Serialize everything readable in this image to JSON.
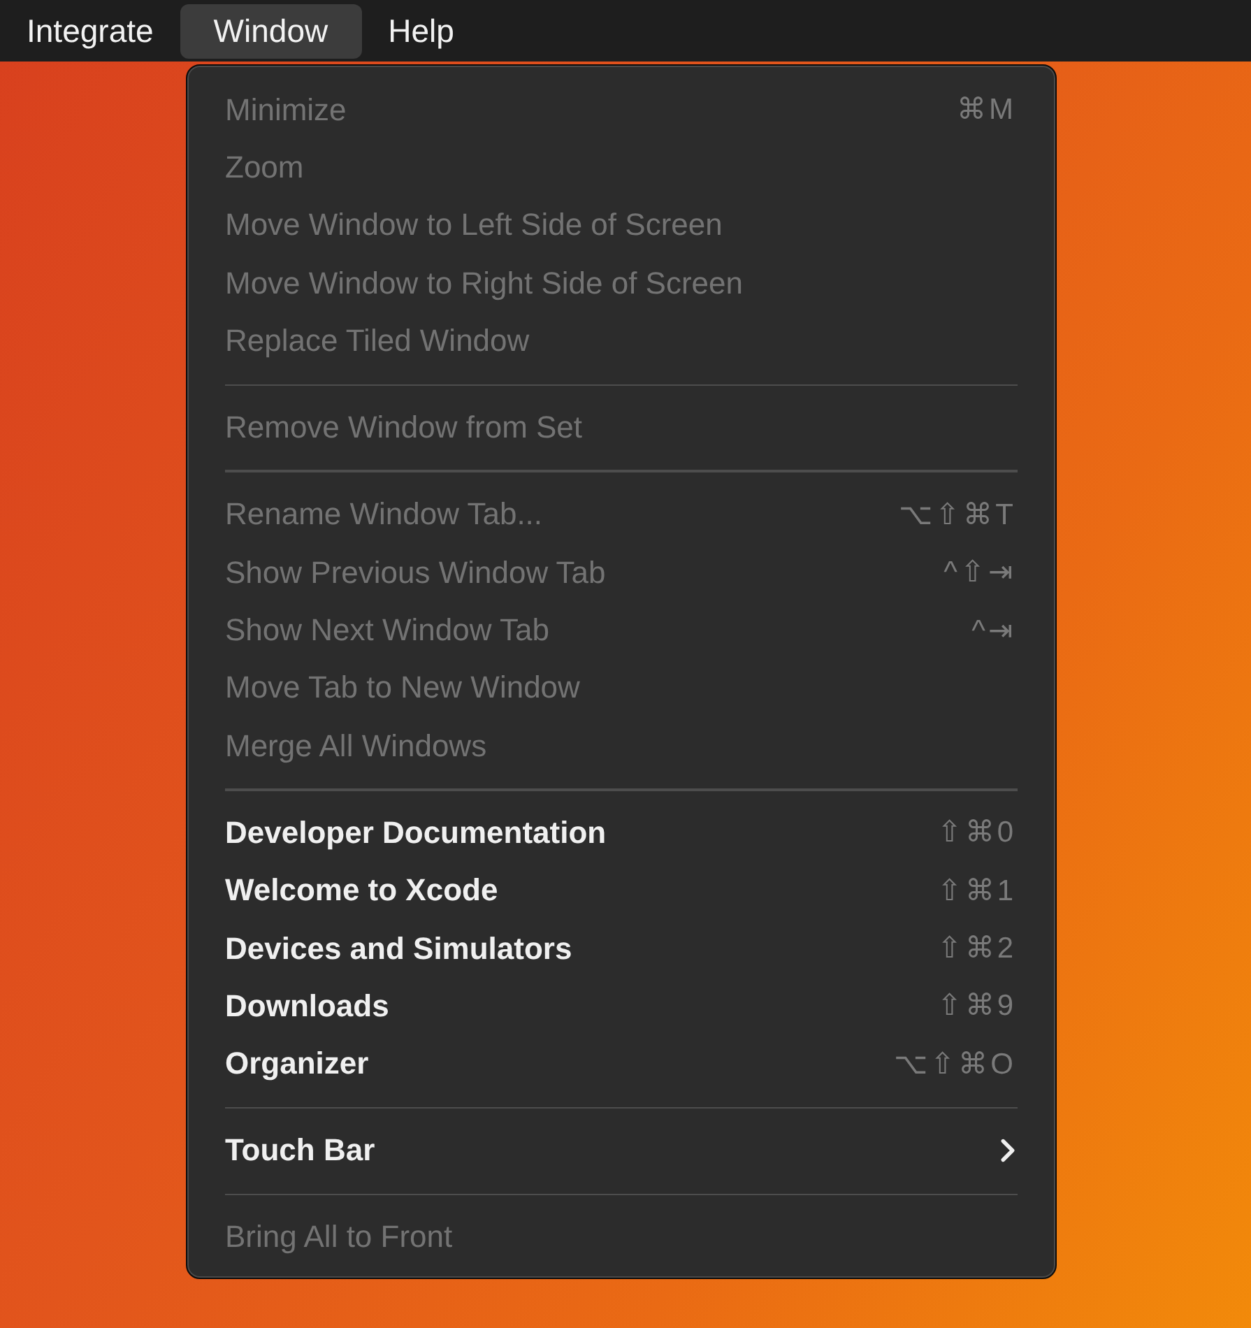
{
  "menu_bar": [
    {
      "label": "Integrate",
      "selected": false
    },
    {
      "label": "Window",
      "selected": true
    },
    {
      "label": "Help",
      "selected": false
    }
  ],
  "menu": {
    "items": [
      {
        "kind": "item",
        "label": "Minimize",
        "shortcut": "⌘M",
        "disabled": true
      },
      {
        "kind": "item",
        "label": "Zoom",
        "disabled": true
      },
      {
        "kind": "item",
        "label": "Move Window to Left Side of Screen",
        "disabled": true
      },
      {
        "kind": "item",
        "label": "Move Window to Right Side of Screen",
        "disabled": true
      },
      {
        "kind": "item",
        "label": "Replace Tiled Window",
        "disabled": true
      },
      {
        "kind": "separator"
      },
      {
        "kind": "item",
        "label": "Remove Window from Set",
        "disabled": true
      },
      {
        "kind": "separator"
      },
      {
        "kind": "item",
        "label": "Rename Window Tab...",
        "shortcut": "⌥⇧⌘T",
        "disabled": true
      },
      {
        "kind": "item",
        "label": "Show Previous Window Tab",
        "shortcut": "^⇧⇥",
        "disabled": true
      },
      {
        "kind": "item",
        "label": "Show Next Window Tab",
        "shortcut": "^⇥",
        "disabled": true
      },
      {
        "kind": "item",
        "label": "Move Tab to New Window",
        "disabled": true
      },
      {
        "kind": "item",
        "label": "Merge All Windows",
        "disabled": true
      },
      {
        "kind": "separator"
      },
      {
        "kind": "item",
        "label": "Developer Documentation",
        "shortcut": "⇧⌘0",
        "disabled": false
      },
      {
        "kind": "item",
        "label": "Welcome to Xcode",
        "shortcut": "⇧⌘1",
        "disabled": false
      },
      {
        "kind": "item",
        "label": "Devices and Simulators",
        "shortcut": "⇧⌘2",
        "disabled": false
      },
      {
        "kind": "item",
        "label": "Downloads",
        "shortcut": "⇧⌘9",
        "disabled": false
      },
      {
        "kind": "item",
        "label": "Organizer",
        "shortcut": "⌥⇧⌘O",
        "disabled": false
      },
      {
        "kind": "separator"
      },
      {
        "kind": "submenu",
        "label": "Touch Bar",
        "disabled": false
      },
      {
        "kind": "separator"
      },
      {
        "kind": "item",
        "label": "Bring All to Front",
        "disabled": true
      }
    ]
  }
}
